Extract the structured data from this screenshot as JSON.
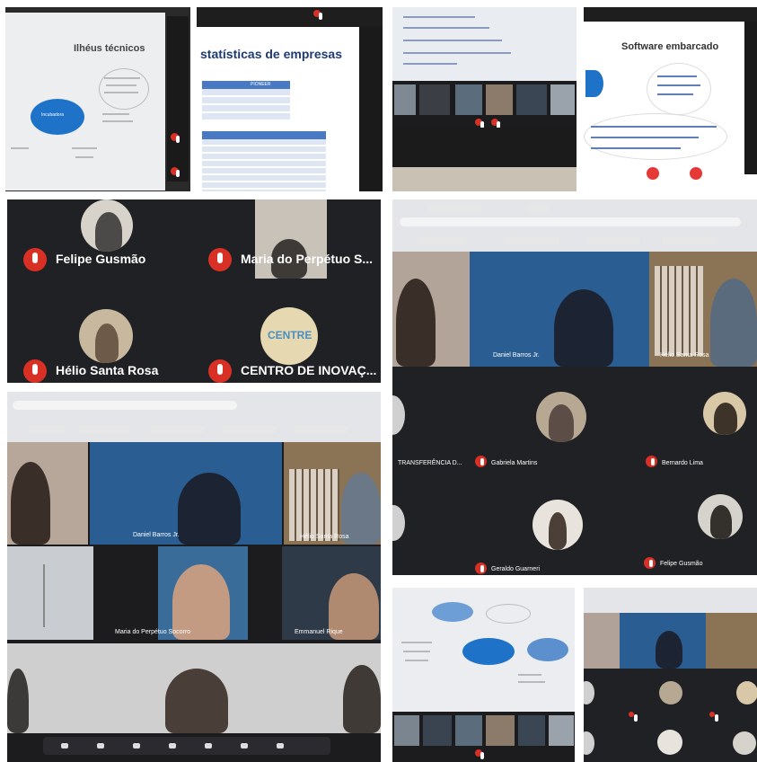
{
  "panel1": {
    "slide_title": "Ilhéus técnicos",
    "center_label": "Incubadora"
  },
  "panel2": {
    "slide_title": "statísticas de empresas",
    "header_right": "PIONEER"
  },
  "panel4": {
    "slide_title": "Software embarcado"
  },
  "panel5": {
    "participants": [
      {
        "name": "Felipe Gusmão"
      },
      {
        "name": "Maria do Perpétuo S..."
      },
      {
        "name": "Hélio Santa Rosa"
      },
      {
        "name": "CENTRO DE INOVAÇ..."
      }
    ],
    "logo_text": "CENTRE"
  },
  "panel6": {
    "tiles": [
      {
        "name": "Daniel Barros Jr."
      },
      {
        "name": "Hélio Santa Rosa"
      }
    ],
    "participants": [
      {
        "name": "TRANSFERÊNCIA D..."
      },
      {
        "name": "Gabriela Martins"
      },
      {
        "name": "Bernardo Lima"
      },
      {
        "name": "Geraldo Guarneri"
      },
      {
        "name": "Felipe Gusmão"
      }
    ]
  },
  "panel7": {
    "names": [
      "Daniel Barros Jr.",
      "Hélio Santa Rosa",
      "Maria do Perpétuo Socorro",
      "Emmanuel Rique"
    ]
  },
  "colors": {
    "dark_bg": "#202124",
    "mic_red": "#d93025",
    "slide_blue": "#1e73c9"
  }
}
